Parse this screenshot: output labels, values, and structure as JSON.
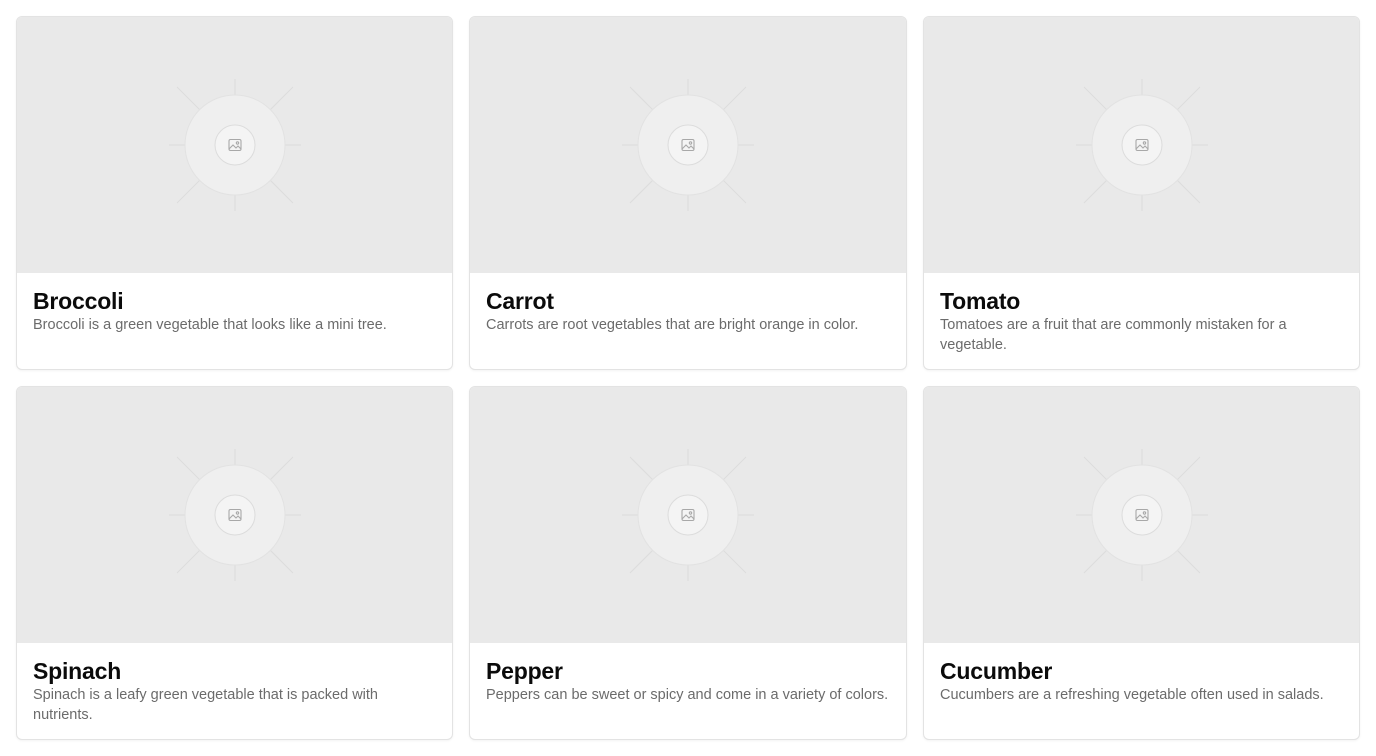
{
  "cards": [
    {
      "title": "Broccoli",
      "description": "Broccoli is a green vegetable that looks like a mini tree.",
      "image_icon": "image-placeholder-icon"
    },
    {
      "title": "Carrot",
      "description": "Carrots are root vegetables that are bright orange in color.",
      "image_icon": "image-placeholder-icon"
    },
    {
      "title": "Tomato",
      "description": "Tomatoes are a fruit that are commonly mistaken for a vegetable.",
      "image_icon": "image-placeholder-icon"
    },
    {
      "title": "Spinach",
      "description": "Spinach is a leafy green vegetable that is packed with nutrients.",
      "image_icon": "image-placeholder-icon"
    },
    {
      "title": "Pepper",
      "description": "Peppers can be sweet or spicy and come in a variety of colors.",
      "image_icon": "image-placeholder-icon"
    },
    {
      "title": "Cucumber",
      "description": "Cucumbers are a refreshing vegetable often used in salads.",
      "image_icon": "image-placeholder-icon"
    }
  ],
  "colors": {
    "placeholder_bg": "#e9e9e9",
    "title": "#0b0b0b",
    "description": "#6b6b6b",
    "border": "#e3e3e3"
  }
}
